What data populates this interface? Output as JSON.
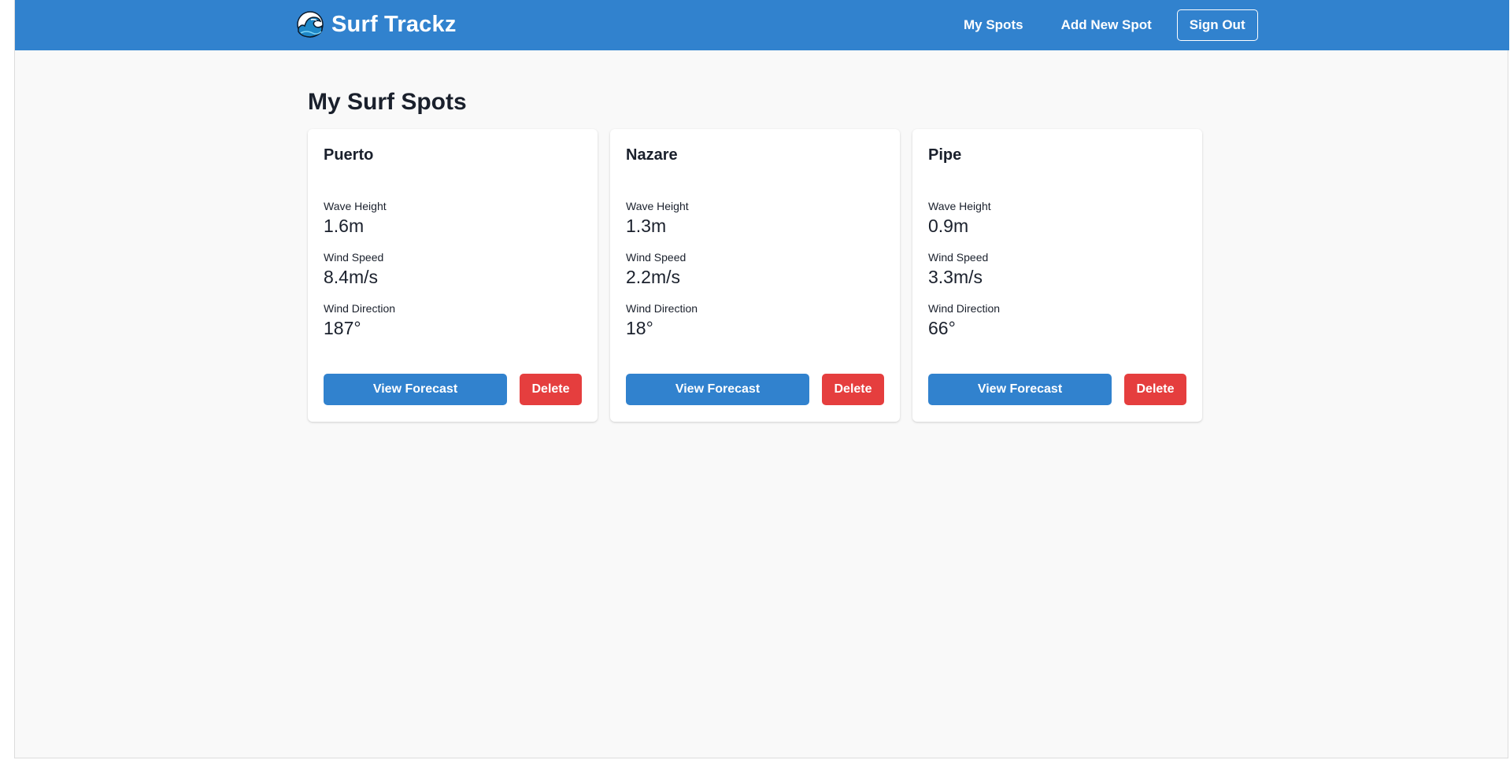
{
  "app": {
    "name": "Surf Trackz",
    "icon": "wave-icon"
  },
  "nav": {
    "my_spots": "My Spots",
    "add_new_spot": "Add New Spot",
    "sign_out": "Sign Out"
  },
  "page": {
    "title": "My Surf Spots"
  },
  "spots": [
    {
      "name": "Puerto",
      "wave_height_label": "Wave Height",
      "wave_height": "1.6m",
      "wind_speed_label": "Wind Speed",
      "wind_speed": "8.4m/s",
      "wind_direction_label": "Wind Direction",
      "wind_direction": "187°",
      "forecast_label": "View Forecast",
      "delete_label": "Delete"
    },
    {
      "name": "Nazare",
      "wave_height_label": "Wave Height",
      "wave_height": "1.3m",
      "wind_speed_label": "Wind Speed",
      "wind_speed": "2.2m/s",
      "wind_direction_label": "Wind Direction",
      "wind_direction": "18°",
      "forecast_label": "View Forecast",
      "delete_label": "Delete"
    },
    {
      "name": "Pipe",
      "wave_height_label": "Wave Height",
      "wave_height": "0.9m",
      "wind_speed_label": "Wind Speed",
      "wind_speed": "3.3m/s",
      "wind_direction_label": "Wind Direction",
      "wind_direction": "66°",
      "forecast_label": "View Forecast",
      "delete_label": "Delete"
    }
  ],
  "colors": {
    "primary": "#3182ce",
    "danger": "#e53e3e",
    "background": "#f9f9f9",
    "text": "#1a202c"
  }
}
